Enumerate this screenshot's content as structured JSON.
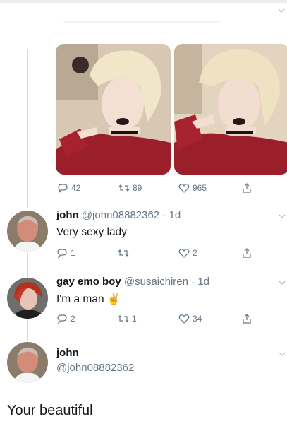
{
  "main_tweet": {
    "images": [
      {
        "alt": "cosplay-photo-1"
      },
      {
        "alt": "cosplay-photo-2"
      }
    ],
    "actions": {
      "replies": "42",
      "retweets": "89",
      "likes": "965"
    }
  },
  "replies": [
    {
      "name": "john",
      "handle": "@john08882362",
      "time": "· 1d",
      "text": "Very sexy lady",
      "actions": {
        "replies": "1",
        "retweets": "",
        "likes": "2"
      }
    },
    {
      "name": "gay emo boy",
      "handle": "@susaichiren",
      "time": "· 1d",
      "text": "I'm a man",
      "emoji": "✌",
      "actions": {
        "replies": "2",
        "retweets": "1",
        "likes": "34"
      }
    }
  ],
  "final": {
    "name": "john",
    "handle": "@john08882362",
    "text": "Your beautiful"
  },
  "colors": {
    "text": "#14171a",
    "secondary": "#657786",
    "thread": "#cfd9de",
    "sweater": "#9b1f2a"
  },
  "icons": [
    "reply-icon",
    "retweet-icon",
    "like-icon",
    "share-icon",
    "chevron-down-icon"
  ]
}
